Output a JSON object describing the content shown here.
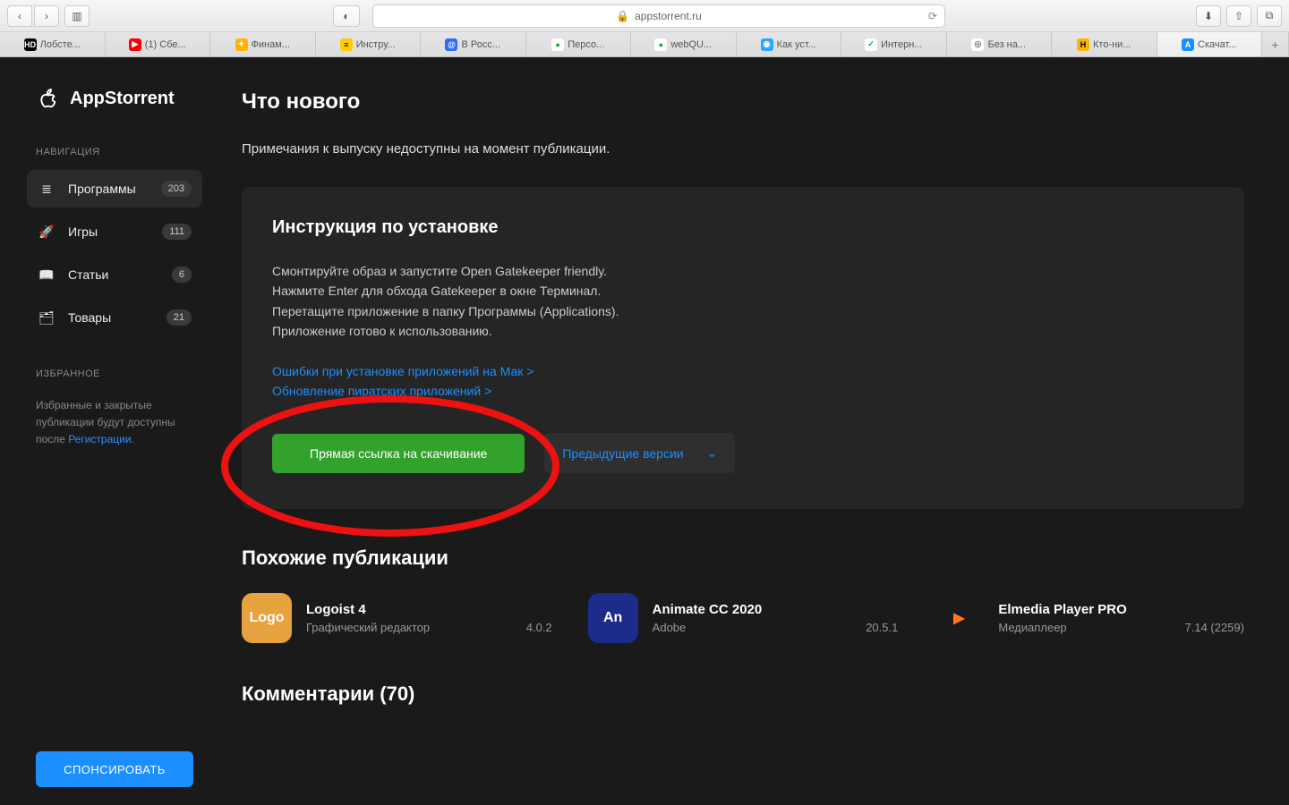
{
  "browser": {
    "url": "appstorrent.ru",
    "tabs": [
      {
        "fav_bg": "#000",
        "fav_fg": "#fff",
        "fav": "HD",
        "label": "Лобсте..."
      },
      {
        "fav_bg": "#ff0000",
        "fav_fg": "#fff",
        "fav": "▶",
        "label": "(1) Сбе..."
      },
      {
        "fav_bg": "#ffb400",
        "fav_fg": "#fff",
        "fav": "✦",
        "label": "Финам..."
      },
      {
        "fav_bg": "#ffcc00",
        "fav_fg": "#000",
        "fav": "≡",
        "label": "Инстру..."
      },
      {
        "fav_bg": "#2d6bff",
        "fav_fg": "#fff",
        "fav": "@",
        "label": "В Росс..."
      },
      {
        "fav_bg": "#fff",
        "fav_fg": "#22a03d",
        "fav": "●",
        "label": "Персо..."
      },
      {
        "fav_bg": "#fff",
        "fav_fg": "#22a03d",
        "fav": "●",
        "label": "webQU..."
      },
      {
        "fav_bg": "#2aa8ff",
        "fav_fg": "#fff",
        "fav": "◉",
        "label": "Как уст..."
      },
      {
        "fav_bg": "#fff",
        "fav_fg": "#22a03d",
        "fav": "✓",
        "label": "Интерн..."
      },
      {
        "fav_bg": "#fff",
        "fav_fg": "#777",
        "fav": "◎",
        "label": "Без на..."
      },
      {
        "fav_bg": "#ffb400",
        "fav_fg": "#000",
        "fav": "H",
        "label": "Кто-ни..."
      },
      {
        "fav_bg": "#1b8fff",
        "fav_fg": "#fff",
        "fav": "A",
        "label": "Скачат...",
        "active": true
      }
    ]
  },
  "site": {
    "brand": "AppStorrent",
    "nav_heading": "НАВИГАЦИЯ",
    "fav_heading": "ИЗБРАННОЕ",
    "nav": [
      {
        "icon": "≣",
        "label": "Программы",
        "badge": "203",
        "active": true
      },
      {
        "icon": "🚀",
        "label": "Игры",
        "badge": "111"
      },
      {
        "icon": "📖",
        "label": "Статьи",
        "badge": "6"
      },
      {
        "icon": "🗂",
        "label": "Товары",
        "badge": "21"
      }
    ],
    "fav_text_a": "Избранные и закрытые публикации будут доступны после ",
    "fav_link": "Регистрации",
    "fav_text_b": ".",
    "sponsor": "СПОНСИРОВАТЬ"
  },
  "content": {
    "whatsnew_title": "Что нового",
    "whatsnew_text": "Примечания к выпуску недоступны на момент публикации.",
    "install_title": "Инструкция по установке",
    "install_steps": "Смонтируйте образ и запустите Open Gatekeeper friendly.\nНажмите Enter для обхода Gatekeeper в окне Терминал.\nПеретащите приложение в папку Программы (Applications).\nПриложение готово к использованию.",
    "install_link1": "Ошибки при установке приложений на Мак >",
    "install_link2": "Обновление пиратских приложений >",
    "download_btn": "Прямая ссылка на скачивание",
    "prev_btn": "Предыдущие версии",
    "similar_title": "Похожие публикации",
    "cards": [
      {
        "icon_bg": "#e6a23c",
        "icon_txt": "Logo",
        "title": "Logoist 4",
        "sub": "Графический редактор",
        "ver": "4.0.2"
      },
      {
        "icon_bg": "#1d2b8a",
        "icon_txt": "An",
        "title": "Animate CC 2020",
        "sub": "Adobe",
        "ver": "20.5.1"
      },
      {
        "icon_bg": "#1a1a1a",
        "icon_txt": "▶",
        "icon_fg": "#ff7a18",
        "title": "Elmedia Player PRO",
        "sub": "Медиаплеер",
        "ver": "7.14 (2259)"
      }
    ],
    "comments_title": "Комментарии (70)"
  }
}
